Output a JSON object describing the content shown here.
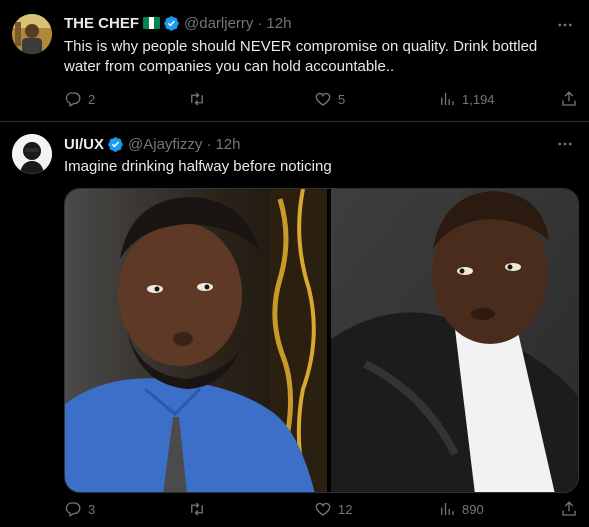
{
  "colors": {
    "background": "#000000",
    "text": "#e7e9ea",
    "muted": "#71767b",
    "verified": "#1d9bf0",
    "divider": "#2f3336"
  },
  "tweets": [
    {
      "name": "THE CHEF",
      "has_flag": true,
      "verified": true,
      "handle": "@darljerry",
      "separator": "·",
      "time": "12h",
      "text": "This is why people should NEVER compromise on quality. Drink bottled water from companies you can hold accountable..",
      "avatar_icon": "profile-photo",
      "actions": {
        "replies": "2",
        "retweets": "",
        "likes": "5",
        "views": "1,194"
      },
      "icons": [
        "reply-icon",
        "retweet-icon",
        "like-icon",
        "views-icon",
        "share-icon",
        "more-icon",
        "verified-badge-icon",
        "nigeria-flag-icon"
      ]
    },
    {
      "name": "UI/UX",
      "has_flag": false,
      "verified": true,
      "handle": "@Ajayfizzy",
      "separator": "·",
      "time": "12h",
      "text": "Imagine drinking halfway before noticing",
      "avatar_icon": "profile-photo",
      "media": "two-panel meme photo",
      "actions": {
        "replies": "3",
        "retweets": "",
        "likes": "12",
        "views": "890"
      },
      "icons": [
        "reply-icon",
        "retweet-icon",
        "like-icon",
        "views-icon",
        "share-icon",
        "more-icon",
        "verified-badge-icon"
      ]
    }
  ]
}
